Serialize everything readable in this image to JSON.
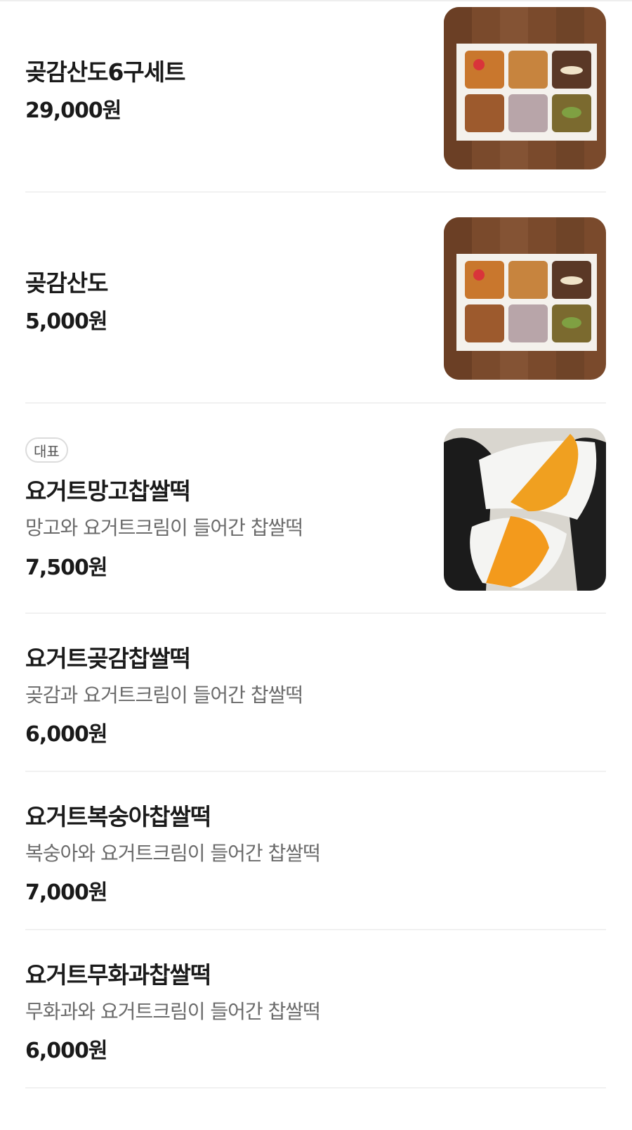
{
  "menu": {
    "items": [
      {
        "name": "곶감산도6구세트",
        "price": "29,000원",
        "image": "sando-box-photo"
      },
      {
        "name": "곶감산도",
        "price": "5,000원",
        "image": "sando-box-photo"
      },
      {
        "badge": "대표",
        "name": "요거트망고찹쌀떡",
        "description": "망고와 요거트크림이 들어간 찹쌀떡",
        "price": "7,500원",
        "image": "mango-rice-cake-photo"
      },
      {
        "name": "요거트곶감찹쌀떡",
        "description": "곶감과 요거트크림이 들어간 찹쌀떡",
        "price": "6,000원"
      },
      {
        "name": "요거트복숭아찹쌀떡",
        "description": "복숭아와 요거트크림이 들어간 찹쌀떡",
        "price": "7,000원"
      },
      {
        "name": "요거트무화과찹쌀떡",
        "description": "무화과와 요거트크림이 들어간 찹쌀떡",
        "price": "6,000원"
      }
    ]
  },
  "colors": {
    "text_primary": "#1a1a1a",
    "text_secondary": "#6b6b6b",
    "divider": "#f1f1f1",
    "badge_border": "#dcdcdc"
  }
}
